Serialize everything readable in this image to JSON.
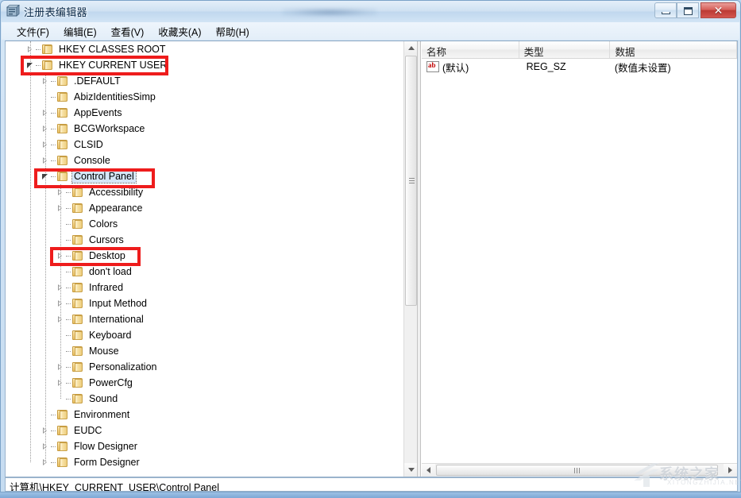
{
  "window": {
    "title": "注册表编辑器",
    "app_icon": "registry-editor-icon",
    "controls": {
      "minimize": "minimize-icon",
      "maximize": "maximize-icon",
      "close": "✕"
    }
  },
  "menubar": {
    "items": [
      {
        "label": "文件(F)",
        "name": "menu-file"
      },
      {
        "label": "编辑(E)",
        "name": "menu-edit"
      },
      {
        "label": "查看(V)",
        "name": "menu-view"
      },
      {
        "label": "收藏夹(A)",
        "name": "menu-favorites"
      },
      {
        "label": "帮助(H)",
        "name": "menu-help"
      }
    ]
  },
  "tree": {
    "items": [
      {
        "label": "HKEY CLASSES ROOT",
        "depth": 0,
        "state": "collapsed",
        "selected": false,
        "annotated": false
      },
      {
        "label": "HKEY CURRENT USER",
        "depth": 0,
        "state": "expanded",
        "selected": false,
        "annotated": true
      },
      {
        "label": ".DEFAULT",
        "depth": 1,
        "state": "collapsed",
        "selected": false,
        "annotated": false
      },
      {
        "label": "AbizIdentitiesSimp",
        "depth": 1,
        "state": "leaf",
        "selected": false,
        "annotated": false
      },
      {
        "label": "AppEvents",
        "depth": 1,
        "state": "collapsed",
        "selected": false,
        "annotated": false
      },
      {
        "label": "BCGWorkspace",
        "depth": 1,
        "state": "collapsed",
        "selected": false,
        "annotated": false
      },
      {
        "label": "CLSID",
        "depth": 1,
        "state": "collapsed",
        "selected": false,
        "annotated": false
      },
      {
        "label": "Console",
        "depth": 1,
        "state": "collapsed",
        "selected": false,
        "annotated": false
      },
      {
        "label": "Control Panel",
        "depth": 1,
        "state": "expanded",
        "selected": true,
        "annotated": true
      },
      {
        "label": "Accessibility",
        "depth": 2,
        "state": "collapsed",
        "selected": false,
        "annotated": false
      },
      {
        "label": "Appearance",
        "depth": 2,
        "state": "collapsed",
        "selected": false,
        "annotated": false
      },
      {
        "label": "Colors",
        "depth": 2,
        "state": "leaf",
        "selected": false,
        "annotated": false
      },
      {
        "label": "Cursors",
        "depth": 2,
        "state": "leaf",
        "selected": false,
        "annotated": false
      },
      {
        "label": "Desktop",
        "depth": 2,
        "state": "collapsed",
        "selected": false,
        "annotated": true
      },
      {
        "label": "don't load",
        "depth": 2,
        "state": "leaf",
        "selected": false,
        "annotated": false
      },
      {
        "label": "Infrared",
        "depth": 2,
        "state": "collapsed",
        "selected": false,
        "annotated": false
      },
      {
        "label": "Input Method",
        "depth": 2,
        "state": "collapsed",
        "selected": false,
        "annotated": false
      },
      {
        "label": "International",
        "depth": 2,
        "state": "collapsed",
        "selected": false,
        "annotated": false
      },
      {
        "label": "Keyboard",
        "depth": 2,
        "state": "leaf",
        "selected": false,
        "annotated": false
      },
      {
        "label": "Mouse",
        "depth": 2,
        "state": "leaf",
        "selected": false,
        "annotated": false
      },
      {
        "label": "Personalization",
        "depth": 2,
        "state": "collapsed",
        "selected": false,
        "annotated": false
      },
      {
        "label": "PowerCfg",
        "depth": 2,
        "state": "collapsed",
        "selected": false,
        "annotated": false
      },
      {
        "label": "Sound",
        "depth": 2,
        "state": "leaf",
        "selected": false,
        "annotated": false
      },
      {
        "label": "Environment",
        "depth": 1,
        "state": "leaf",
        "selected": false,
        "annotated": false
      },
      {
        "label": "EUDC",
        "depth": 1,
        "state": "collapsed",
        "selected": false,
        "annotated": false
      },
      {
        "label": "Flow Designer",
        "depth": 1,
        "state": "collapsed",
        "selected": false,
        "annotated": false
      },
      {
        "label": "Form Designer",
        "depth": 1,
        "state": "collapsed",
        "selected": false,
        "annotated": false
      }
    ]
  },
  "list": {
    "columns": [
      {
        "label": "名称",
        "name": "column-name"
      },
      {
        "label": "类型",
        "name": "column-type"
      },
      {
        "label": "数据",
        "name": "column-data"
      }
    ],
    "rows": [
      {
        "icon": "string-value-icon",
        "name": "(默认)",
        "type": "REG_SZ",
        "data": "(数值未设置)"
      }
    ]
  },
  "statusbar": {
    "path": "计算机\\HKEY_CURRENT_USER\\Control Panel"
  },
  "watermark": {
    "text": "系统之家",
    "sub": "XITONGZHIJIA.NET"
  },
  "colors": {
    "annotation_red": "#ee1c1c",
    "selection_blue": "#d5e6f7",
    "title_text": "#0b2a49"
  }
}
